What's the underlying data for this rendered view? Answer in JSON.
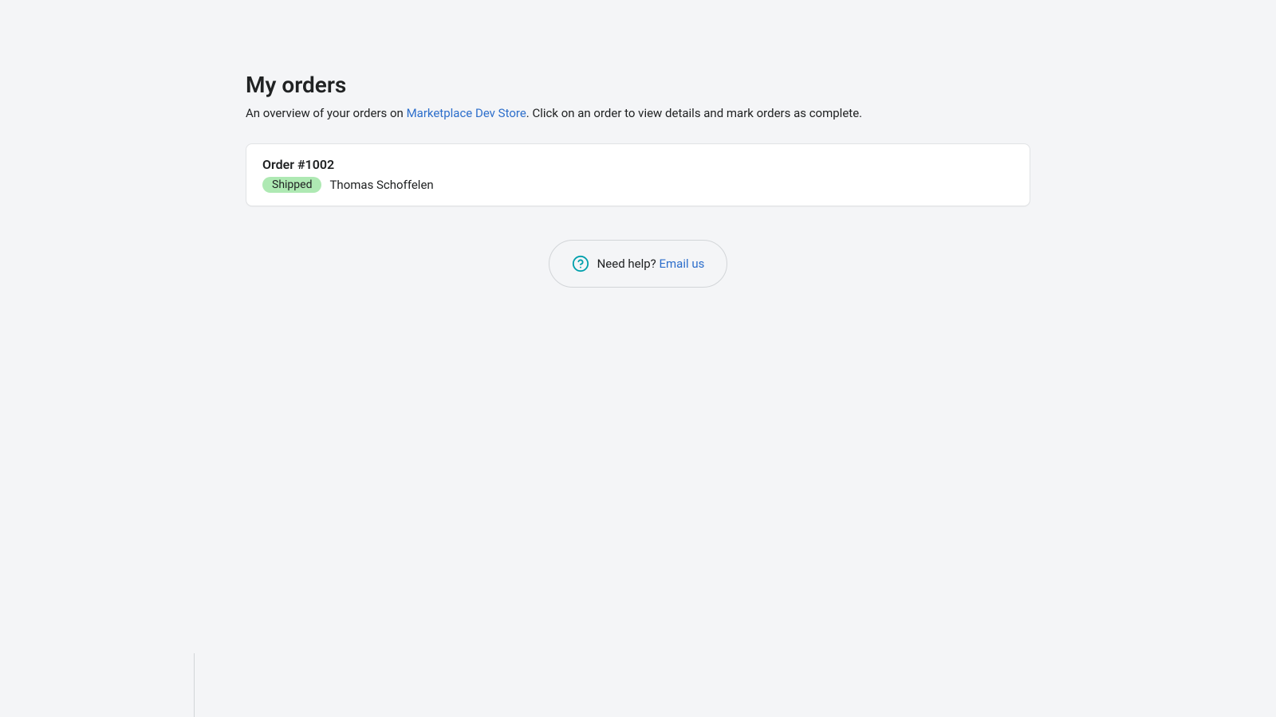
{
  "header": {
    "title": "My orders",
    "subtitle_prefix": "An overview of your orders on ",
    "store_link_text": "Marketplace Dev Store",
    "subtitle_suffix": ". Click on an order to view details and mark orders as complete."
  },
  "orders": [
    {
      "title": "Order #1002",
      "status": "Shipped",
      "customer": "Thomas Schoffelen"
    }
  ],
  "help": {
    "prompt": "Need help? ",
    "link_text": "Email us"
  }
}
